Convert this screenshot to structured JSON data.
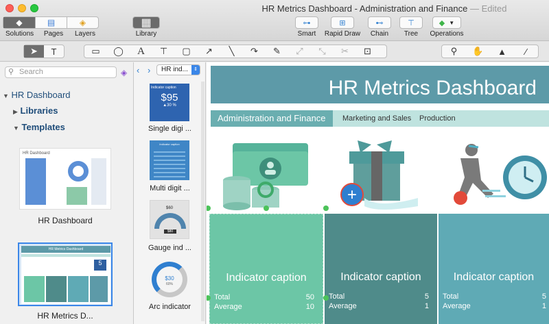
{
  "window": {
    "title": "HR Metrics Dashboard - Administration and Finance",
    "edited": "— Edited"
  },
  "toolbar": {
    "solutions": "Solutions",
    "pages": "Pages",
    "layers": "Layers",
    "library": "Library",
    "smart": "Smart",
    "rapid_draw": "Rapid Draw",
    "chain": "Chain",
    "tree": "Tree",
    "operations": "Operations"
  },
  "sidebar": {
    "search_placeholder": "Search",
    "root": "HR Dashboard",
    "libraries": "Libraries",
    "templates": "Templates",
    "template_items": [
      "HR Dashboard",
      "HR Metrics D..."
    ]
  },
  "library": {
    "dropdown": "HR ind...",
    "items": [
      {
        "label": "Single digi ...",
        "caption": "Indicator caption",
        "value": "$95",
        "delta": "▲30 %"
      },
      {
        "label": "Multi digit ...",
        "caption": "Indicator caption"
      },
      {
        "label": "Gauge ind ...",
        "top": "$60",
        "value": "$80"
      },
      {
        "label": "Arc indicator",
        "value": "$30",
        "pct": "60%"
      }
    ]
  },
  "dashboard": {
    "title": "HR Metrics Dashboard",
    "tabs": [
      "Administration and Finance",
      "Marketing and Sales",
      "Production"
    ],
    "cards": [
      {
        "caption": "Indicator caption",
        "total_label": "Total",
        "total": "50",
        "avg_label": "Average",
        "avg": "10"
      },
      {
        "caption": "Indicator caption",
        "total_label": "Total",
        "total": "5",
        "avg_label": "Average",
        "avg": "1"
      },
      {
        "caption": "Indicator caption",
        "total_label": "Total",
        "total": "5",
        "avg_label": "Average",
        "avg": "1"
      }
    ],
    "plus": "+"
  },
  "thumb_text": {
    "hr_dashboard": "HR Dashboard",
    "hr_metrics": "HR Metrics Dashboard",
    "digit": "5"
  },
  "colors": {
    "header": "#5d9aa8",
    "card1": "#6cc6a6",
    "card2": "#4f8b8a",
    "card3": "#5faab5",
    "accent": "#2f7fd0"
  }
}
